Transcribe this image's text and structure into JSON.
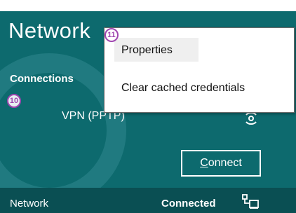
{
  "panel": {
    "title": "Network",
    "connections_label": "Connections",
    "vpn_name": "VPN (PPTP)",
    "connect_button": "Connect",
    "connect_button_accesskey": "C",
    "connect_button_rest": "onnect",
    "bottom": {
      "network_label": "Network",
      "status": "Connected"
    }
  },
  "context_menu": {
    "items": [
      {
        "label": "Properties"
      },
      {
        "label": "Clear cached credentials"
      }
    ]
  },
  "annotations": {
    "badge_10": "10",
    "badge_11": "11"
  },
  "colors": {
    "panel_bg": "#0d6a6e",
    "bottom_bar_bg": "#0a4f53",
    "badge_ring": "#a046b0"
  },
  "icons": {
    "vpn": "vpn-connection-icon",
    "network": "wired-network-icon"
  }
}
